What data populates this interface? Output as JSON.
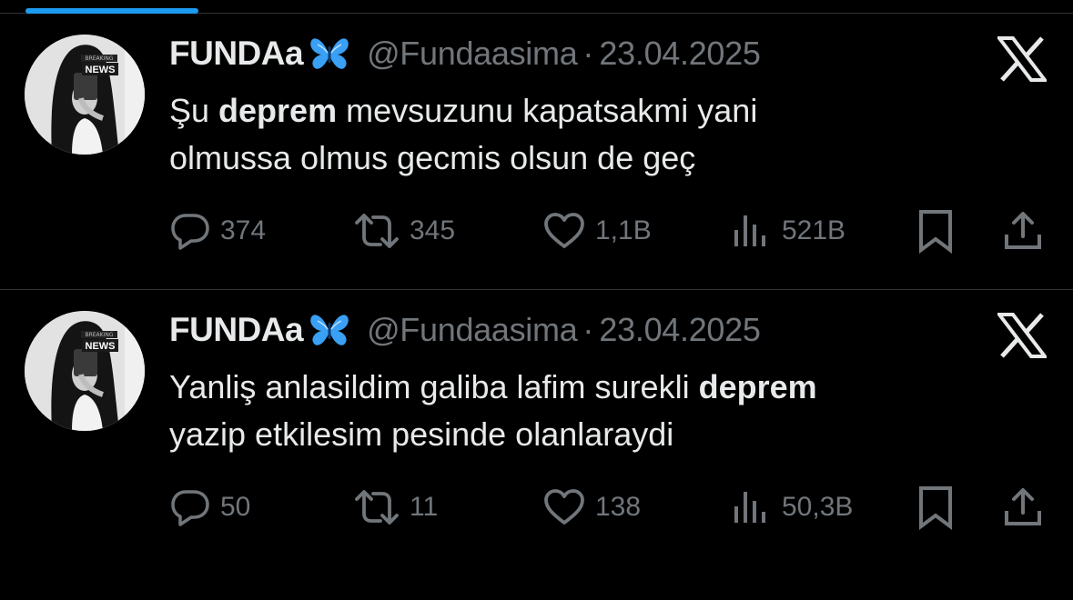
{
  "tweets": [
    {
      "display_name": "FUNDAa",
      "handle": "@Fundaasima",
      "separator": "·",
      "date": "23.04.2025",
      "avatar_badge": "NEWS",
      "text_parts": {
        "line1_prefix": "Şu ",
        "line1_bold": "deprem",
        "line1_suffix": " mevsuzunu kapatsakmi yani",
        "line2": "olmussa olmus gecmis olsun de geç"
      },
      "stats": {
        "replies": "374",
        "retweets": "345",
        "likes": "1,1B",
        "views": "521B"
      }
    },
    {
      "display_name": "FUNDAa",
      "handle": "@Fundaasima",
      "separator": "·",
      "date": "23.04.2025",
      "avatar_badge": "NEWS",
      "text_parts": {
        "line1_prefix": "Yanliş anlasildim galiba lafim surekli ",
        "line1_bold": "deprem",
        "line2": "yazip etkilesim pesinde olanlaraydi"
      },
      "stats": {
        "replies": "50",
        "retweets": "11",
        "likes": "138",
        "views": "50,3B"
      }
    }
  ],
  "icons": {
    "butterfly": "blue-butterfly-emoji",
    "platform": "x-logo-icon",
    "reply": "reply-icon",
    "retweet": "retweet-icon",
    "like": "heart-icon",
    "views": "views-icon",
    "bookmark": "bookmark-icon",
    "share": "share-icon"
  },
  "colors": {
    "background": "#000000",
    "text": "#e7e9ea",
    "muted": "#71767b",
    "accent": "#1d9bf0",
    "divider": "#2f3336"
  }
}
